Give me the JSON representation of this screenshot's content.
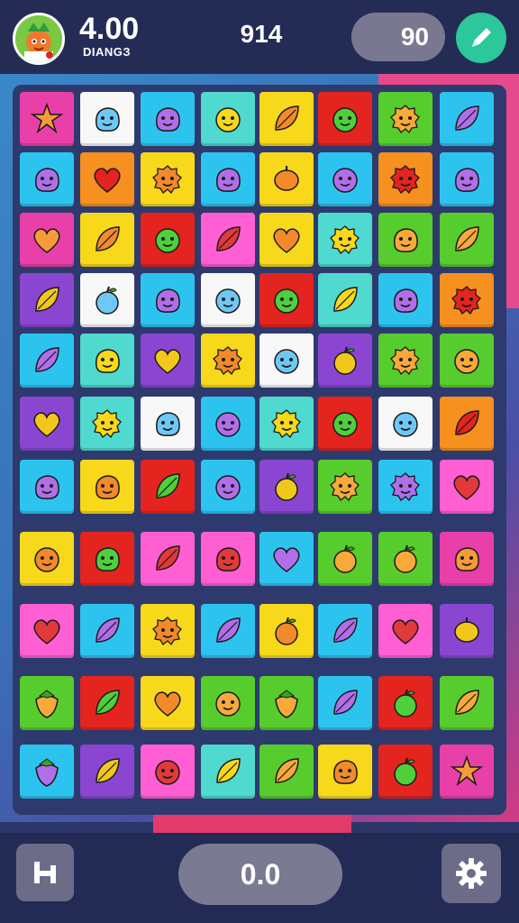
{
  "header": {
    "score": "4.00",
    "score_sub": "DIANGЗ",
    "moves": "914",
    "pill_value": "90"
  },
  "footer": {
    "pill_value": "0.0"
  },
  "colors": {
    "pink": "#e93fa9",
    "white": "#f8f8f8",
    "cyan": "#2cc4ef",
    "teal": "#4fd9cf",
    "yellow": "#f7d81b",
    "red": "#e4241f",
    "green": "#57cc2d",
    "orange": "#f6901e",
    "purple": "#8a46d1",
    "magenta": "#ff5fd3"
  },
  "board": {
    "columns": 8,
    "rows": [
      [
        [
          "pink",
          "star-icon"
        ],
        [
          "white",
          "blob-icon"
        ],
        [
          "cyan",
          "blob-icon"
        ],
        [
          "teal",
          "face-icon"
        ],
        [
          "yellow",
          "leaf-icon"
        ],
        [
          "red",
          "face-icon"
        ],
        [
          "green",
          "fuzzy-icon"
        ],
        [
          "cyan",
          "leaf-icon"
        ]
      ],
      [
        [
          "cyan",
          "blob-icon"
        ],
        [
          "orange",
          "heart-icon"
        ],
        [
          "yellow",
          "fuzzy-icon"
        ],
        [
          "cyan",
          "blob-icon"
        ],
        [
          "yellow",
          "fruit-icon"
        ],
        [
          "cyan",
          "face-icon"
        ],
        [
          "orange",
          "fuzzy-icon"
        ],
        [
          "cyan",
          "blob-icon"
        ]
      ],
      [
        [
          "pink",
          "heart-icon"
        ],
        [
          "yellow",
          "leaf-icon"
        ],
        [
          "red",
          "face-icon"
        ],
        [
          "magenta",
          "leaf-icon"
        ],
        [
          "yellow",
          "heart-icon"
        ],
        [
          "teal",
          "fuzzy-icon"
        ],
        [
          "green",
          "blob-icon"
        ],
        [
          "green",
          "leaf-icon"
        ]
      ],
      [
        [
          "purple",
          "leaf-icon"
        ],
        [
          "white",
          "apple-icon"
        ],
        [
          "cyan",
          "blob-icon"
        ],
        [
          "white",
          "face-icon"
        ],
        [
          "red",
          "face-icon"
        ],
        [
          "teal",
          "leaf-icon"
        ],
        [
          "cyan",
          "blob-icon"
        ],
        [
          "orange",
          "fuzzy-icon"
        ]
      ],
      [
        [
          "cyan",
          "leaf-icon"
        ],
        [
          "teal",
          "blob-icon"
        ],
        [
          "purple",
          "heart-icon"
        ],
        [
          "yellow",
          "fuzzy-icon"
        ],
        [
          "white",
          "face-icon"
        ],
        [
          "purple",
          "apple-icon"
        ],
        [
          "green",
          "fuzzy-icon"
        ],
        [
          "green",
          "face-icon"
        ]
      ],
      [
        [
          "purple",
          "heart-icon"
        ],
        [
          "teal",
          "fuzzy-icon"
        ],
        [
          "white",
          "blob-icon"
        ],
        [
          "cyan",
          "face-icon"
        ],
        [
          "teal",
          "fuzzy-icon"
        ],
        [
          "red",
          "face-icon"
        ],
        [
          "white",
          "face-icon"
        ],
        [
          "orange",
          "leaf-icon"
        ]
      ],
      [
        [
          "cyan",
          "blob-icon"
        ],
        [
          "yellow",
          "blob-icon"
        ],
        [
          "red",
          "leaf-icon"
        ],
        [
          "cyan",
          "face-icon"
        ],
        [
          "purple",
          "apple-icon"
        ],
        [
          "green",
          "fuzzy-icon"
        ],
        [
          "cyan",
          "fuzzy-icon"
        ],
        [
          "magenta",
          "heart-icon"
        ]
      ],
      [
        [
          "yellow",
          "face-icon"
        ],
        [
          "red",
          "blob-icon"
        ],
        [
          "magenta",
          "leaf-icon"
        ],
        [
          "magenta",
          "blob-icon"
        ],
        [
          "cyan",
          "heart-icon"
        ],
        [
          "green",
          "apple-icon"
        ],
        [
          "green",
          "apple-icon"
        ],
        [
          "pink",
          "blob-icon"
        ]
      ],
      [
        [
          "magenta",
          "heart-icon"
        ],
        [
          "cyan",
          "leaf-icon"
        ],
        [
          "yellow",
          "fuzzy-icon"
        ],
        [
          "cyan",
          "leaf-icon"
        ],
        [
          "yellow",
          "apple-icon"
        ],
        [
          "cyan",
          "leaf-icon"
        ],
        [
          "magenta",
          "heart-icon"
        ],
        [
          "purple",
          "fruit-icon"
        ]
      ],
      [
        [
          "green",
          "strawberry-icon"
        ],
        [
          "red",
          "leaf-icon"
        ],
        [
          "yellow",
          "heart-icon"
        ],
        [
          "green",
          "face-icon"
        ],
        [
          "green",
          "strawberry-icon"
        ],
        [
          "cyan",
          "leaf-icon"
        ],
        [
          "red",
          "apple-icon"
        ],
        [
          "green",
          "leaf-icon"
        ]
      ],
      [
        [
          "cyan",
          "strawberry-icon"
        ],
        [
          "purple",
          "leaf-icon"
        ],
        [
          "magenta",
          "face-icon"
        ],
        [
          "teal",
          "leaf-icon"
        ],
        [
          "green",
          "leaf-icon"
        ],
        [
          "yellow",
          "blob-icon"
        ],
        [
          "red",
          "apple-icon"
        ],
        [
          "pink",
          "star-icon"
        ]
      ]
    ]
  }
}
